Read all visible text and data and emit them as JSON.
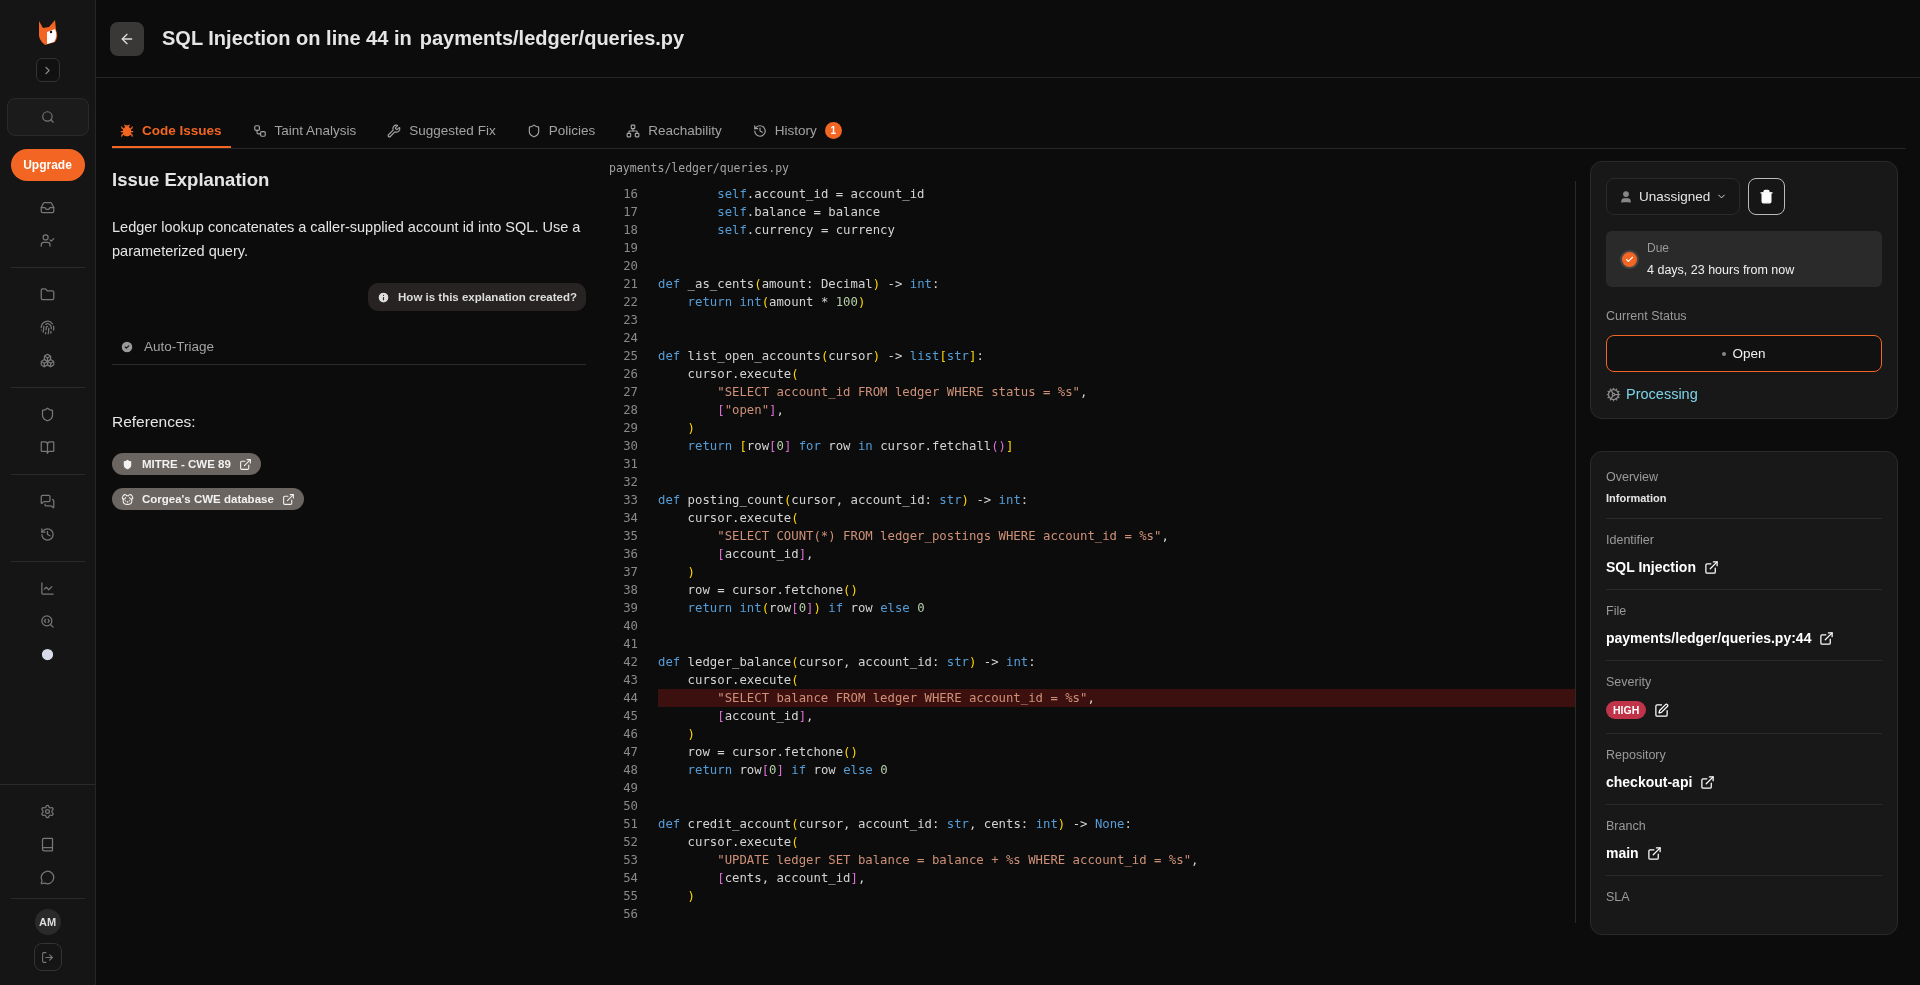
{
  "sidebar": {
    "upgrade_label": "Upgrade",
    "avatar": "AM",
    "groups": [
      [
        {
          "selected": false
        },
        {
          "selected": false
        }
      ],
      [
        {
          "selected": false
        },
        {
          "selected": false
        },
        {
          "selected": false
        }
      ],
      [
        {
          "selected": false
        },
        {
          "selected": false
        }
      ],
      [
        {
          "selected": false
        },
        {
          "selected": false
        }
      ],
      [
        {
          "selected": false
        },
        {
          "selected": false
        },
        {
          "selected": true
        }
      ]
    ],
    "bottom": [
      {
        "selected": false
      },
      {
        "selected": false
      },
      {
        "selected": false
      }
    ]
  },
  "header": {
    "title_prefix": "SQL Injection on line 44 in",
    "title_path": "payments/ledger/queries.py"
  },
  "tabs": [
    {
      "label": "Code Issues",
      "selected": true
    },
    {
      "label": "Taint Analysis",
      "selected": false
    },
    {
      "label": "Suggested Fix",
      "selected": false
    },
    {
      "label": "Policies",
      "selected": false
    },
    {
      "label": "Reachability",
      "selected": false
    },
    {
      "label": "History",
      "selected": false,
      "badge": "1"
    }
  ],
  "explanation": {
    "heading": "Issue Explanation",
    "text": "Ledger lookup concatenates a caller-supplied account id into SQL. Use a parameterized query.",
    "help_button": "How is this explanation created?",
    "auto_triage": "Auto-Triage",
    "references_heading": "References:",
    "references": [
      {
        "label": "MITRE - CWE 89"
      },
      {
        "label": "Corgea's CWE database"
      }
    ]
  },
  "code": {
    "filename": "payments/ledger/queries.py",
    "lines": [
      {
        "n": "16",
        "hl": false,
        "t": [
          {
            "kind": "kw",
            "text": "        self"
          },
          {
            "kind": "p",
            "text": ".account_id = account_id"
          }
        ]
      },
      {
        "n": "17",
        "hl": false,
        "t": [
          {
            "kind": "kw",
            "text": "        self"
          },
          {
            "kind": "p",
            "text": ".balance = balance"
          }
        ]
      },
      {
        "n": "18",
        "hl": false,
        "t": [
          {
            "kind": "kw",
            "text": "        self"
          },
          {
            "kind": "p",
            "text": ".currency = currency"
          }
        ]
      },
      {
        "n": "19",
        "hl": false
      },
      {
        "n": "20",
        "hl": false
      },
      {
        "n": "21",
        "hl": false,
        "t": [
          {
            "kind": "kw",
            "text": "def"
          },
          {
            "kind": "p",
            "text": " _as_cents"
          },
          {
            "kind": "b1",
            "text": "("
          },
          {
            "kind": "p",
            "text": "amount: Decimal"
          },
          {
            "kind": "b1",
            "text": ")"
          },
          {
            "kind": "p",
            "text": " -> "
          },
          {
            "kind": "kw",
            "text": "int"
          },
          {
            "kind": "p",
            "text": ":"
          }
        ]
      },
      {
        "n": "22",
        "hl": false,
        "t": [
          {
            "kind": "kw",
            "text": "    return "
          },
          {
            "kind": "kw",
            "text": "int"
          },
          {
            "kind": "b1",
            "text": "("
          },
          {
            "kind": "p",
            "text": "amount * "
          },
          {
            "kind": "num",
            "text": "100"
          },
          {
            "kind": "b1",
            "text": ")"
          }
        ]
      },
      {
        "n": "23",
        "hl": false
      },
      {
        "n": "24",
        "hl": false
      },
      {
        "n": "25",
        "hl": false,
        "t": [
          {
            "kind": "kw",
            "text": "def"
          },
          {
            "kind": "p",
            "text": " list_open_accounts"
          },
          {
            "kind": "b1",
            "text": "("
          },
          {
            "kind": "p",
            "text": "cursor"
          },
          {
            "kind": "b1",
            "text": ")"
          },
          {
            "kind": "p",
            "text": " -> "
          },
          {
            "kind": "kw",
            "text": "list"
          },
          {
            "kind": "b1",
            "text": "["
          },
          {
            "kind": "kw",
            "text": "str"
          },
          {
            "kind": "b1",
            "text": "]"
          },
          {
            "kind": "p",
            "text": ":"
          }
        ]
      },
      {
        "n": "26",
        "hl": false,
        "t": [
          {
            "kind": "p",
            "text": "    cursor.execute"
          },
          {
            "kind": "b1",
            "text": "("
          }
        ]
      },
      {
        "n": "27",
        "hl": false,
        "t": [
          {
            "kind": "str",
            "text": "        \"SELECT account_id FROM ledger WHERE status = %s\""
          },
          {
            "kind": "p",
            "text": ","
          }
        ]
      },
      {
        "n": "28",
        "hl": false,
        "t": [
          {
            "kind": "b2",
            "text": "        ["
          },
          {
            "kind": "str",
            "text": "\"open\""
          },
          {
            "kind": "b2",
            "text": "]"
          },
          {
            "kind": "p",
            "text": ","
          }
        ]
      },
      {
        "n": "29",
        "hl": false,
        "t": [
          {
            "kind": "b1",
            "text": "    )"
          }
        ]
      },
      {
        "n": "30",
        "hl": false,
        "t": [
          {
            "kind": "kw",
            "text": "    return "
          },
          {
            "kind": "b1",
            "text": "["
          },
          {
            "kind": "p",
            "text": "row"
          },
          {
            "kind": "b2",
            "text": "["
          },
          {
            "kind": "num",
            "text": "0"
          },
          {
            "kind": "b2",
            "text": "] "
          },
          {
            "kind": "kw",
            "text": "for"
          },
          {
            "kind": "p",
            "text": " row "
          },
          {
            "kind": "kw",
            "text": "in"
          },
          {
            "kind": "p",
            "text": " cursor.fetchall"
          },
          {
            "kind": "b2",
            "text": "()"
          },
          {
            "kind": "b1",
            "text": "]"
          }
        ]
      },
      {
        "n": "31",
        "hl": false
      },
      {
        "n": "32",
        "hl": false
      },
      {
        "n": "33",
        "hl": false,
        "t": [
          {
            "kind": "kw",
            "text": "def"
          },
          {
            "kind": "p",
            "text": " posting_count"
          },
          {
            "kind": "b1",
            "text": "("
          },
          {
            "kind": "p",
            "text": "cursor, account_id: "
          },
          {
            "kind": "kw",
            "text": "str"
          },
          {
            "kind": "b1",
            "text": ")"
          },
          {
            "kind": "p",
            "text": " -> "
          },
          {
            "kind": "kw",
            "text": "int"
          },
          {
            "kind": "p",
            "text": ":"
          }
        ]
      },
      {
        "n": "34",
        "hl": false,
        "t": [
          {
            "kind": "p",
            "text": "    cursor.execute"
          },
          {
            "kind": "b1",
            "text": "("
          }
        ]
      },
      {
        "n": "35",
        "hl": false,
        "t": [
          {
            "kind": "str",
            "text": "        \"SELECT COUNT(*) FROM ledger_postings WHERE account_id = %s\""
          },
          {
            "kind": "p",
            "text": ","
          }
        ]
      },
      {
        "n": "36",
        "hl": false,
        "t": [
          {
            "kind": "b2",
            "text": "        ["
          },
          {
            "kind": "p",
            "text": "account_id"
          },
          {
            "kind": "b2",
            "text": "]"
          },
          {
            "kind": "p",
            "text": ","
          }
        ]
      },
      {
        "n": "37",
        "hl": false,
        "t": [
          {
            "kind": "b1",
            "text": "    )"
          }
        ]
      },
      {
        "n": "38",
        "hl": false,
        "t": [
          {
            "kind": "p",
            "text": "    row = cursor.fetchone"
          },
          {
            "kind": "b1",
            "text": "()"
          }
        ]
      },
      {
        "n": "39",
        "hl": false,
        "t": [
          {
            "kind": "kw",
            "text": "    return "
          },
          {
            "kind": "kw",
            "text": "int"
          },
          {
            "kind": "b1",
            "text": "("
          },
          {
            "kind": "p",
            "text": "row"
          },
          {
            "kind": "b2",
            "text": "["
          },
          {
            "kind": "num",
            "text": "0"
          },
          {
            "kind": "b2",
            "text": "]"
          },
          {
            "kind": "b1",
            "text": ") "
          },
          {
            "kind": "kw",
            "text": "if"
          },
          {
            "kind": "p",
            "text": " row "
          },
          {
            "kind": "kw",
            "text": "else "
          },
          {
            "kind": "num",
            "text": "0"
          }
        ]
      },
      {
        "n": "40",
        "hl": false
      },
      {
        "n": "41",
        "hl": false
      },
      {
        "n": "42",
        "hl": false,
        "t": [
          {
            "kind": "kw",
            "text": "def"
          },
          {
            "kind": "p",
            "text": " ledger_balance"
          },
          {
            "kind": "b1",
            "text": "("
          },
          {
            "kind": "p",
            "text": "cursor, account_id: "
          },
          {
            "kind": "kw",
            "text": "str"
          },
          {
            "kind": "b1",
            "text": ")"
          },
          {
            "kind": "p",
            "text": " -> "
          },
          {
            "kind": "kw",
            "text": "int"
          },
          {
            "kind": "p",
            "text": ":"
          }
        ]
      },
      {
        "n": "43",
        "hl": false,
        "t": [
          {
            "kind": "p",
            "text": "    cursor.execute"
          },
          {
            "kind": "b1",
            "text": "("
          }
        ]
      },
      {
        "n": "44",
        "hl": true,
        "t": [
          {
            "kind": "str",
            "text": "        \"SELECT balance FROM ledger WHERE account_id = %s\""
          },
          {
            "kind": "p",
            "text": ","
          }
        ]
      },
      {
        "n": "45",
        "hl": false,
        "t": [
          {
            "kind": "b2",
            "text": "        ["
          },
          {
            "kind": "p",
            "text": "account_id"
          },
          {
            "kind": "b2",
            "text": "]"
          },
          {
            "kind": "p",
            "text": ","
          }
        ]
      },
      {
        "n": "46",
        "hl": false,
        "t": [
          {
            "kind": "b1",
            "text": "    )"
          }
        ]
      },
      {
        "n": "47",
        "hl": false,
        "t": [
          {
            "kind": "p",
            "text": "    row = cursor.fetchone"
          },
          {
            "kind": "b1",
            "text": "()"
          }
        ]
      },
      {
        "n": "48",
        "hl": false,
        "t": [
          {
            "kind": "kw",
            "text": "    return"
          },
          {
            "kind": "p",
            "text": " row"
          },
          {
            "kind": "b2",
            "text": "["
          },
          {
            "kind": "num",
            "text": "0"
          },
          {
            "kind": "b2",
            "text": "] "
          },
          {
            "kind": "kw",
            "text": "if"
          },
          {
            "kind": "p",
            "text": " row "
          },
          {
            "kind": "kw",
            "text": "else "
          },
          {
            "kind": "num",
            "text": "0"
          }
        ]
      },
      {
        "n": "49",
        "hl": false
      },
      {
        "n": "50",
        "hl": false
      },
      {
        "n": "51",
        "hl": false,
        "t": [
          {
            "kind": "kw",
            "text": "def"
          },
          {
            "kind": "p",
            "text": " credit_account"
          },
          {
            "kind": "b1",
            "text": "("
          },
          {
            "kind": "p",
            "text": "cursor, account_id: "
          },
          {
            "kind": "kw",
            "text": "str"
          },
          {
            "kind": "p",
            "text": ", cents: "
          },
          {
            "kind": "kw",
            "text": "int"
          },
          {
            "kind": "b1",
            "text": ")"
          },
          {
            "kind": "p",
            "text": " -> "
          },
          {
            "kind": "kw",
            "text": "None"
          },
          {
            "kind": "p",
            "text": ":"
          }
        ]
      },
      {
        "n": "52",
        "hl": false,
        "t": [
          {
            "kind": "p",
            "text": "    cursor.execute"
          },
          {
            "kind": "b1",
            "text": "("
          }
        ]
      },
      {
        "n": "53",
        "hl": false,
        "t": [
          {
            "kind": "str",
            "text": "        \"UPDATE ledger SET balance = balance + %s WHERE account_id = %s\""
          },
          {
            "kind": "p",
            "text": ","
          }
        ]
      },
      {
        "n": "54",
        "hl": false,
        "t": [
          {
            "kind": "b2",
            "text": "        ["
          },
          {
            "kind": "p",
            "text": "cents, account_id"
          },
          {
            "kind": "b2",
            "text": "]"
          },
          {
            "kind": "p",
            "text": ","
          }
        ]
      },
      {
        "n": "55",
        "hl": false,
        "t": [
          {
            "kind": "b1",
            "text": "    )"
          }
        ]
      },
      {
        "n": "56",
        "hl": false
      }
    ]
  },
  "status_card": {
    "assignee": "Unassigned",
    "due_label": "Due",
    "due_value": "4 days, 23 hours from now",
    "status_label": "Current Status",
    "status": "Open",
    "processing": "Processing"
  },
  "overview": {
    "title": "Overview",
    "subtitle": "Information",
    "fields": [
      {
        "label": "Identifier",
        "value": "SQL Injection",
        "kind": "link"
      },
      {
        "label": "File",
        "value": "payments/ledger/queries.py:44",
        "kind": "link"
      },
      {
        "label": "Severity",
        "value": "HIGH",
        "kind": "severity"
      },
      {
        "label": "Repository",
        "value": "checkout-api",
        "kind": "link"
      },
      {
        "label": "Branch",
        "value": "main",
        "kind": "link"
      },
      {
        "label": "SLA",
        "kind": "label"
      }
    ]
  }
}
